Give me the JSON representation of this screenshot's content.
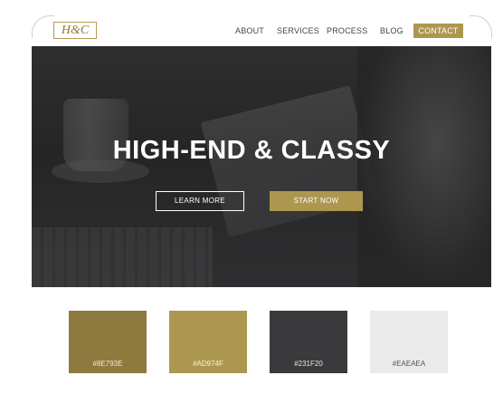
{
  "brand": {
    "logo_text": "H&C"
  },
  "nav": {
    "items": [
      {
        "label": "ABOUT"
      },
      {
        "label": "SERVICES"
      },
      {
        "label": "PROCESS"
      },
      {
        "label": "BLOG"
      }
    ],
    "cta_label": "CONTACT"
  },
  "hero": {
    "headline": "HIGH-END & CLASSY",
    "secondary_button": "LEARN MORE",
    "primary_button": "START NOW"
  },
  "palette": [
    {
      "hex": "#8E793E",
      "label": "#8E793E"
    },
    {
      "hex": "#AD974F",
      "label": "#AD974F"
    },
    {
      "hex": "#231F20",
      "label": "#231F20"
    },
    {
      "hex": "#EAEAEA",
      "label": "#EAEAEA"
    }
  ],
  "colors": {
    "accent": "#AD974F",
    "accent_dark": "#8E793E"
  }
}
